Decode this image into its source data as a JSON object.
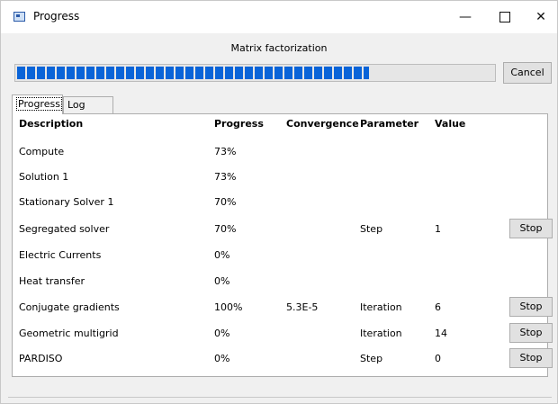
{
  "window": {
    "title": "Progress",
    "icon": "app-window-icon",
    "controls": {
      "minimize": "—",
      "maximize": "",
      "close": "✕"
    }
  },
  "task": {
    "label": "Matrix factorization",
    "progress_fraction": 0.74,
    "cancel_label": "Cancel"
  },
  "tabs": [
    {
      "label": "Progress",
      "active": true
    },
    {
      "label": "Log",
      "active": false
    }
  ],
  "table": {
    "headers": [
      "Description",
      "Progress",
      "Convergence",
      "Parameter",
      "Value"
    ],
    "stop_label": "Stop",
    "rows": [
      {
        "description": "Compute",
        "progress": "73%",
        "convergence": "",
        "parameter": "",
        "value": "",
        "stop": false
      },
      {
        "description": "Solution 1",
        "progress": "73%",
        "convergence": "",
        "parameter": "",
        "value": "",
        "stop": false
      },
      {
        "description": "Stationary Solver 1",
        "progress": "70%",
        "convergence": "",
        "parameter": "",
        "value": "",
        "stop": false
      },
      {
        "description": "Segregated solver",
        "progress": "70%",
        "convergence": "",
        "parameter": "Step",
        "value": "1",
        "stop": true
      },
      {
        "description": "Electric Currents",
        "progress": "0%",
        "convergence": "",
        "parameter": "",
        "value": "",
        "stop": false
      },
      {
        "description": "Heat transfer",
        "progress": "0%",
        "convergence": "",
        "parameter": "",
        "value": "",
        "stop": false
      },
      {
        "description": "Conjugate gradients",
        "progress": "100%",
        "convergence": "5.3E-5",
        "parameter": "Iteration",
        "value": "6",
        "stop": true
      },
      {
        "description": "Geometric multigrid",
        "progress": "0%",
        "convergence": "",
        "parameter": "Iteration",
        "value": "14",
        "stop": true
      },
      {
        "description": "PARDISO",
        "progress": "0%",
        "convergence": "",
        "parameter": "Step",
        "value": "0",
        "stop": true
      }
    ]
  }
}
